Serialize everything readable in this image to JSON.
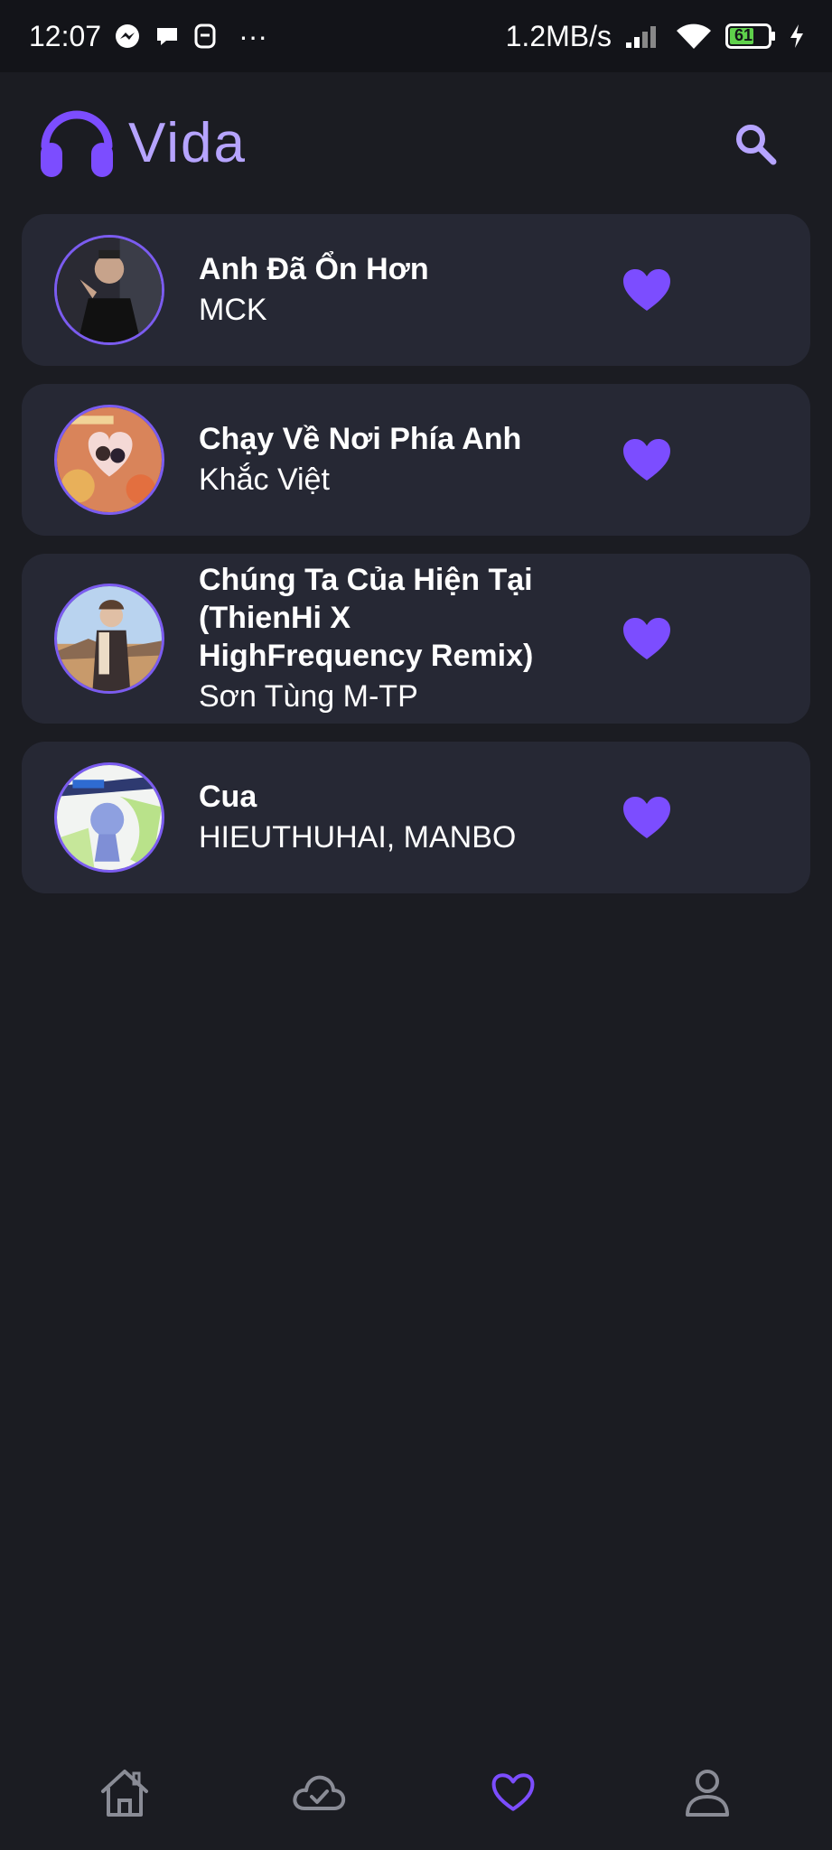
{
  "status_bar": {
    "time": "12:07",
    "more": "···",
    "speed": "1.2MB/s",
    "battery": "61"
  },
  "header": {
    "app_name": "Vida",
    "logo_icon": "headphones-icon",
    "search_icon": "search-icon"
  },
  "colors": {
    "accent": "#7c4dff",
    "brand_text": "#b6a4ff",
    "background": "#1b1c22",
    "card": "#262834"
  },
  "songs": [
    {
      "title": "Anh Đã Ổn Hơn",
      "artist": "MCK"
    },
    {
      "title": "Chạy Về Nơi Phía Anh",
      "artist": "Khắc Việt"
    },
    {
      "title": "Chúng Ta Của Hiện Tại (ThienHi X HighFrequency Remix)",
      "artist": "Sơn Tùng M-TP"
    },
    {
      "title": "Cua",
      "artist": "HIEUTHUHAI, MANBO"
    }
  ],
  "nav": {
    "items": [
      "home-icon",
      "cloud-check-icon",
      "heart-icon",
      "user-icon"
    ],
    "active": "heart-icon"
  }
}
